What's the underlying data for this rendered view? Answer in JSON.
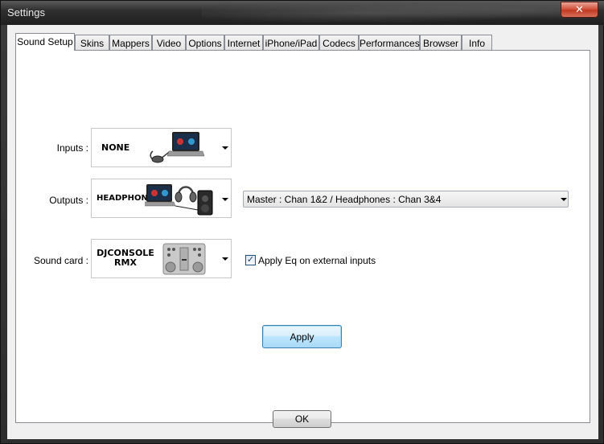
{
  "window": {
    "title": "Settings",
    "close_glyph": "✕"
  },
  "tabs": [
    {
      "label": "Sound Setup",
      "active": true
    },
    {
      "label": "Skins"
    },
    {
      "label": "Mappers"
    },
    {
      "label": "Video"
    },
    {
      "label": "Options"
    },
    {
      "label": "Internet"
    },
    {
      "label": "iPhone/iPad"
    },
    {
      "label": "Codecs"
    },
    {
      "label": "Performances"
    },
    {
      "label": "Browser"
    },
    {
      "label": "Info"
    }
  ],
  "sound_setup": {
    "inputs": {
      "label": "Inputs :",
      "value": "NONE",
      "icon": "laptop-with-mouse-icon"
    },
    "outputs": {
      "label": "Outputs :",
      "value": "HEADPHONES",
      "icon": "laptop-headphones-speaker-icon"
    },
    "sound_card": {
      "label": "Sound card :",
      "value_line1": "DJCONSOLE",
      "value_line2": "RMX",
      "icon": "dj-controller-icon"
    },
    "channel_mapping": {
      "value": "Master : Chan 1&2 / Headphones : Chan 3&4"
    },
    "apply_eq": {
      "label": "Apply Eq on external inputs",
      "checked": true,
      "check_glyph": "✓"
    },
    "apply_label": "Apply"
  },
  "footer": {
    "ok_label": "OK"
  },
  "colors": {
    "accent": "#3c7fb1",
    "close": "#c03a22"
  }
}
